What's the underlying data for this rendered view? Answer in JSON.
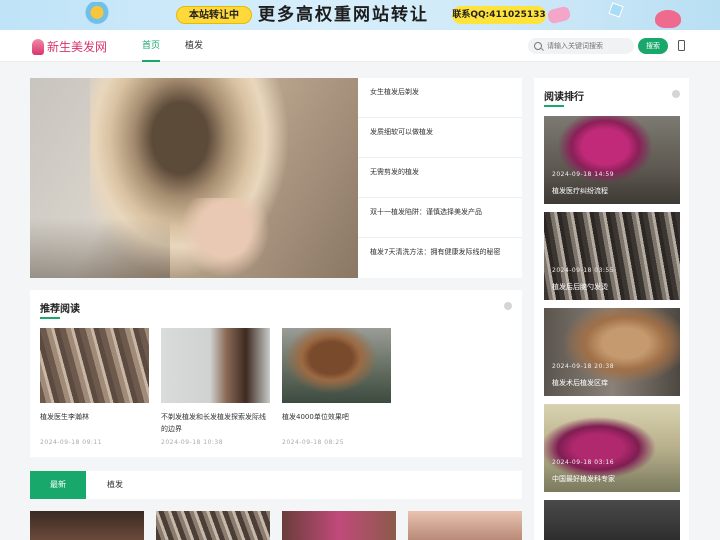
{
  "banner": {
    "tag": "本站转让中",
    "slogan": "更多高权重网站转让",
    "contact": "联系QQ:411025133"
  },
  "header": {
    "logo_text": "新生美发网",
    "nav": [
      {
        "label": "首页",
        "active": true
      },
      {
        "label": "植发",
        "active": false
      }
    ],
    "search_placeholder": "请输入关键词搜索",
    "search_button": "搜索"
  },
  "hero": {
    "links": [
      "女生植发后剃发",
      "发质细软可以做植发",
      "无需剪发的植发",
      "双十一植发陷阱：谨慎选择美发产品",
      "植发7天清洗方法：拥有健康发际线的秘密"
    ]
  },
  "recommend": {
    "title": "推荐阅读",
    "items": [
      {
        "title": "植发医生李瀚林",
        "date": "2024-09-18 09:11"
      },
      {
        "title": "不剃发植发和长发植发探索发际线的边界",
        "date": "2024-09-18 10:38"
      },
      {
        "title": "植发4000单位效果吧",
        "date": "2024-09-18 08:25"
      }
    ]
  },
  "latest": {
    "tabs": [
      "最新",
      "植发"
    ]
  },
  "ranking": {
    "title": "阅读排行",
    "items": [
      {
        "date": "2024-09-18 14:59",
        "title": "植发医疗纠纷流程"
      },
      {
        "date": "2024-09-18 03:55",
        "title": "植发后后脑勺发烫"
      },
      {
        "date": "2024-09-18 20:38",
        "title": "植发术后植发区痒"
      },
      {
        "date": "2024-09-18 03:16",
        "title": "中国最好植发科专家"
      }
    ]
  },
  "colors": {
    "accent": "#18a86b",
    "logo": "#d8356e"
  }
}
